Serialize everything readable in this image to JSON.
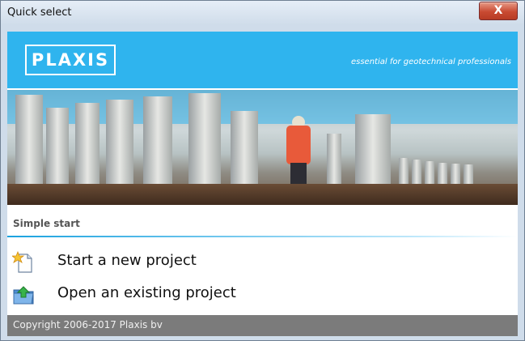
{
  "window": {
    "title": "Quick select",
    "close_symbol": "X"
  },
  "header": {
    "logo_text": "PLAXIS",
    "tagline": "essential for geotechnical professionals"
  },
  "section": {
    "title": "Simple start"
  },
  "items": [
    {
      "label": "Start a new project",
      "icon": "new-project-icon"
    },
    {
      "label": "Open an existing project",
      "icon": "open-project-icon"
    }
  ],
  "footer": {
    "copyright": "Copyright 2006-2017 Plaxis bv"
  },
  "colors": {
    "header_blue": "#2fb4ee",
    "footer_gray": "#7b7b7b",
    "close_red": "#c94a32"
  }
}
